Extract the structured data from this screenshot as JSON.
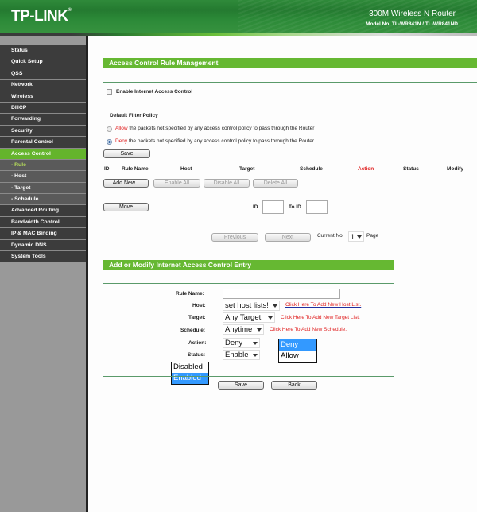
{
  "header": {
    "logo": "TP-LINK",
    "product": "300M Wireless N Router",
    "model": "Model No. TL-WR841N / TL-WR841ND"
  },
  "sidebar": {
    "items": [
      {
        "label": "Status",
        "type": "main",
        "state": ""
      },
      {
        "label": "Quick Setup",
        "type": "main",
        "state": ""
      },
      {
        "label": "QSS",
        "type": "main",
        "state": ""
      },
      {
        "label": "Network",
        "type": "main",
        "state": ""
      },
      {
        "label": "Wireless",
        "type": "main",
        "state": ""
      },
      {
        "label": "DHCP",
        "type": "main",
        "state": ""
      },
      {
        "label": "Forwarding",
        "type": "main",
        "state": ""
      },
      {
        "label": "Security",
        "type": "main",
        "state": ""
      },
      {
        "label": "Parental Control",
        "type": "main",
        "state": ""
      },
      {
        "label": "Access Control",
        "type": "main",
        "state": "active"
      },
      {
        "label": "- Rule",
        "type": "sub",
        "state": "current"
      },
      {
        "label": "- Host",
        "type": "sub",
        "state": ""
      },
      {
        "label": "- Target",
        "type": "sub",
        "state": ""
      },
      {
        "label": "- Schedule",
        "type": "sub",
        "state": ""
      },
      {
        "label": "Advanced Routing",
        "type": "main",
        "state": ""
      },
      {
        "label": "Bandwidth Control",
        "type": "main",
        "state": ""
      },
      {
        "label": "IP & MAC Binding",
        "type": "main",
        "state": ""
      },
      {
        "label": "Dynamic DNS",
        "type": "main",
        "state": ""
      },
      {
        "label": "System Tools",
        "type": "main",
        "state": ""
      }
    ]
  },
  "management": {
    "title": "Access Control Rule Management",
    "enable_label": "Enable Internet Access Control",
    "enable_checked": false,
    "policy_heading": "Default Filter Policy",
    "allow_word": "Allow",
    "allow_text": "the packets not specified by any access control policy to pass through the Router",
    "deny_word": "Deny",
    "deny_text": "the packets not specified by any access control policy to pass through the Router",
    "selected_policy": "deny",
    "save_label": "Save",
    "columns": [
      "ID",
      "Rule Name",
      "Host",
      "Target",
      "Schedule",
      "Action",
      "Status",
      "Modify"
    ],
    "add_new_label": "Add New...",
    "enable_all_label": "Enable All",
    "disable_all_label": "Disable All",
    "delete_all_label": "Delete All",
    "move_label": "Move",
    "id_label": "ID",
    "id_value": "",
    "to_id_label": "To ID",
    "to_id_value": "",
    "previous_label": "Previous",
    "next_label": "Next",
    "current_no_label": "Current No.",
    "current_page": "1",
    "page_label": "Page"
  },
  "entry": {
    "title": "Add or Modify Internet Access Control Entry",
    "rule_name_label": "Rule Name:",
    "rule_name_value": "",
    "host_label": "Host:",
    "host_value": "set host lists!",
    "host_link": "Click Here To Add New Host List.",
    "target_label": "Target:",
    "target_value": "Any Target",
    "target_link": "Click Here To Add New Target List.",
    "schedule_label": "Schedule:",
    "schedule_value": "Anytime",
    "schedule_link": "Click Here To Add New Schedule.",
    "action_label": "Action:",
    "action_value": "Deny",
    "action_options": [
      "Deny",
      "Allow"
    ],
    "status_label": "Status:",
    "status_value": "Enable",
    "status_options": [
      "Disabled",
      "Enabled"
    ],
    "save_label": "Save",
    "back_label": "Back"
  }
}
